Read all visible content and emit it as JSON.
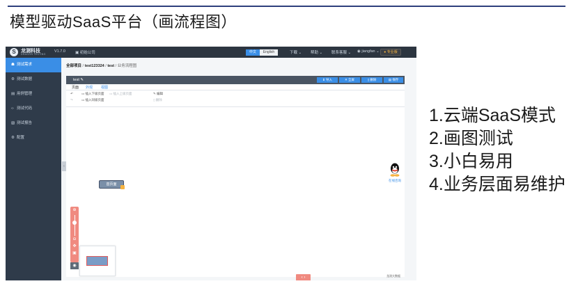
{
  "slide": {
    "title": "模型驱动SaaS平台（画流程图）",
    "features": [
      "1.云端SaaS模式",
      "2.画图测试",
      "3.小白易用",
      "4.业务层面易维护"
    ]
  },
  "app": {
    "logo_glyph": "S",
    "brand": "龙测科技",
    "brand_sub": "DRAGON TESTING",
    "version": "V1.7.0",
    "company": "初始公司",
    "lang_cn": "中文",
    "lang_en": "English",
    "top_menu": [
      "下载",
      "帮助",
      "联系客服",
      "jiangfan"
    ],
    "pro_badge": "专业版"
  },
  "sidebar": {
    "items": [
      {
        "label": "测试需求",
        "icon": "requirement-icon",
        "glyph": "☗",
        "active": true
      },
      {
        "label": "测试数据",
        "icon": "data-icon",
        "glyph": "⚙",
        "active": false
      },
      {
        "label": "用例管理",
        "icon": "case-icon",
        "glyph": "▤",
        "active": false
      },
      {
        "label": "测试代码",
        "icon": "code-icon",
        "glyph": "‹›",
        "active": false
      },
      {
        "label": "测试报告",
        "icon": "report-icon",
        "glyph": "▧",
        "active": false
      },
      {
        "label": "配置",
        "icon": "config-icon",
        "glyph": "⚙",
        "active": false
      }
    ]
  },
  "breadcrumb": [
    "全部项目",
    "test123324",
    "test",
    "业务流程图"
  ],
  "toolbar": {
    "title": "test",
    "buttons": [
      "导入",
      "全屏",
      "删除",
      "保存"
    ]
  },
  "tabs": [
    "页面",
    "外观",
    "视图"
  ],
  "ops": {
    "insert_child": "插入下级页面",
    "insert_parent": "插入上级页面",
    "insert_sibling": "插入同级页面",
    "edit": "编辑",
    "delete": "删除"
  },
  "canvas": {
    "node_label": "首页面",
    "qq_label": "在线咨询",
    "footer_mark": "龙测大数据",
    "pager": "‹ ›"
  }
}
